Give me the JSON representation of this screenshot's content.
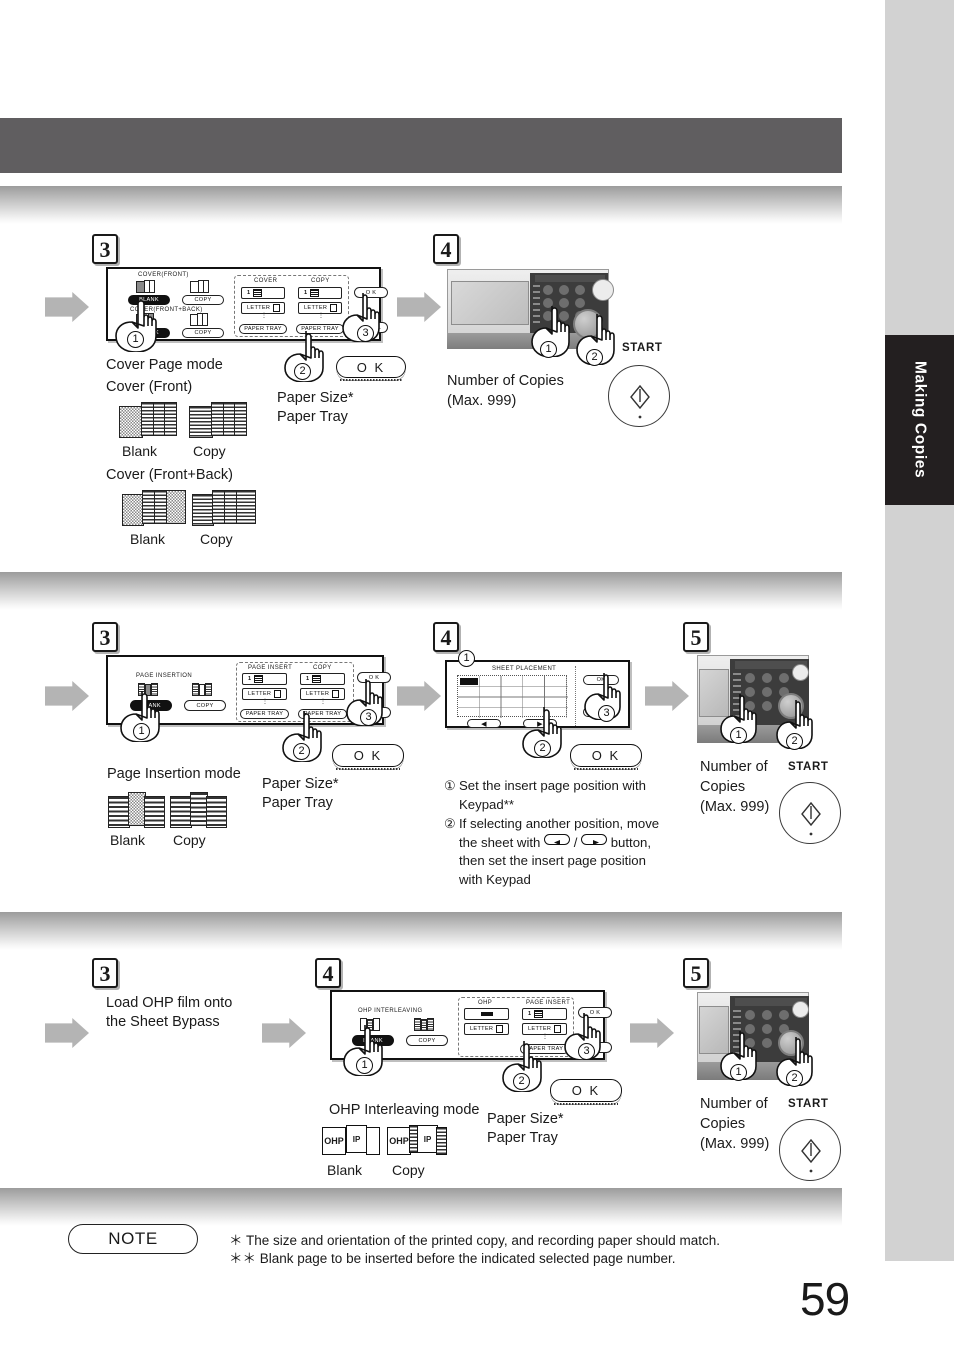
{
  "page": {
    "number": "59",
    "side_tab_label": "Making Copies"
  },
  "sections": [
    {
      "id": "cover-page",
      "steps": [
        {
          "num": "3",
          "mode_caption": "Cover Page mode",
          "sub_caption_1": "Cover (Front)",
          "sub_caption_2": "Cover (Front+Back)",
          "paper_caption_line1": "Paper Size*",
          "paper_caption_line2": "Paper Tray",
          "doc_labels": [
            "Blank",
            "Copy",
            "Blank",
            "Copy"
          ],
          "lcd": {
            "title": "COVER(FRONT)",
            "title2": "COVER(FRONT+BACK)",
            "group_headers": [
              "COVER",
              "COPY"
            ],
            "count_value": "1",
            "paper_size": "LETTER",
            "paper_tray_label": "PAPER TRAY",
            "blank_label": "BLANK",
            "copy_label": "COPY",
            "ok_label": "O K",
            "cancel_label": "CANCEL"
          },
          "ok_callout": "O K",
          "hand_numbers": [
            "1",
            "2",
            "3"
          ]
        },
        {
          "num": "4",
          "copies_line1": "Number of Copies",
          "copies_line2": "(Max. 999)",
          "start_label": "START",
          "hand_numbers": [
            "1",
            "2"
          ]
        }
      ]
    },
    {
      "id": "page-insertion",
      "steps": [
        {
          "num": "3",
          "mode_caption": "Page Insertion mode",
          "paper_caption_line1": "Paper Size*",
          "paper_caption_line2": "Paper Tray",
          "doc_labels": [
            "Blank",
            "Copy"
          ],
          "lcd": {
            "title": "PAGE INSERTION",
            "group_headers": [
              "PAGE INSERT",
              "COPY"
            ],
            "count_value": "1",
            "paper_size": "LETTER",
            "paper_tray_label": "PAPER TRAY",
            "blank_label": "BLANK",
            "copy_label": "COPY",
            "ok_label": "O K"
          },
          "ok_callout": "O K",
          "hand_numbers": [
            "1",
            "2",
            "3"
          ]
        },
        {
          "num": "4",
          "lcd": {
            "title": "SHEET PLACEMENT",
            "ok_label": "OK",
            "left_arrow": "◀",
            "right_arrow": "▶"
          },
          "ok_callout": "O K",
          "hand_numbers": [
            "1",
            "2",
            "3"
          ],
          "instructions": [
            {
              "n": "①",
              "text_a": "Set the insert page position with",
              "text_b": "Keypad**"
            },
            {
              "n": "②",
              "text_a": "If selecting another position, move",
              "text_b": "the sheet with",
              "text_c": "button,",
              "text_d": "then set the insert page position",
              "text_e": "with Keypad"
            }
          ]
        },
        {
          "num": "5",
          "copies_line1": "Number of",
          "copies_line2": "Copies",
          "copies_line3": "(Max. 999)",
          "start_label": "START",
          "hand_numbers": [
            "1",
            "2"
          ]
        }
      ]
    },
    {
      "id": "ohp-interleaving",
      "steps": [
        {
          "num": "3",
          "caption_line1": "Load OHP film onto",
          "caption_line2": "the Sheet Bypass"
        },
        {
          "num": "4",
          "mode_caption": "OHP Interleaving mode",
          "paper_caption_line1": "Paper Size*",
          "paper_caption_line2": "Paper Tray",
          "doc_labels": [
            "Blank",
            "Copy"
          ],
          "doc_tags": [
            "OHP",
            "IP"
          ],
          "lcd": {
            "title": "OHP INTERLEAVING",
            "group_headers": [
              "OHP",
              "PAGE INSERT"
            ],
            "count_value": "1",
            "paper_size": "LETTER",
            "paper_tray_label": "PAPER TRAY",
            "blank_label": "BLANK",
            "copy_label": "COPY",
            "ok_label": "O K"
          },
          "ok_callout": "O K",
          "hand_numbers": [
            "1",
            "2",
            "3"
          ]
        },
        {
          "num": "5",
          "copies_line1": "Number of",
          "copies_line2": "Copies",
          "copies_line3": "(Max. 999)",
          "start_label": "START",
          "hand_numbers": [
            "1",
            "2"
          ]
        }
      ]
    }
  ],
  "note": {
    "label": "NOTE",
    "lines": [
      "＊ The size and orientation of the printed copy, and recording paper should match.",
      "＊＊ Blank page to be inserted before the indicated selected page number."
    ]
  },
  "colors": {
    "top_bar": "#605e60",
    "side_tab": "#231f20",
    "right_margin": "#d2d2d2",
    "arrow": "#b4b4b4",
    "text": "#1a1a1a"
  }
}
